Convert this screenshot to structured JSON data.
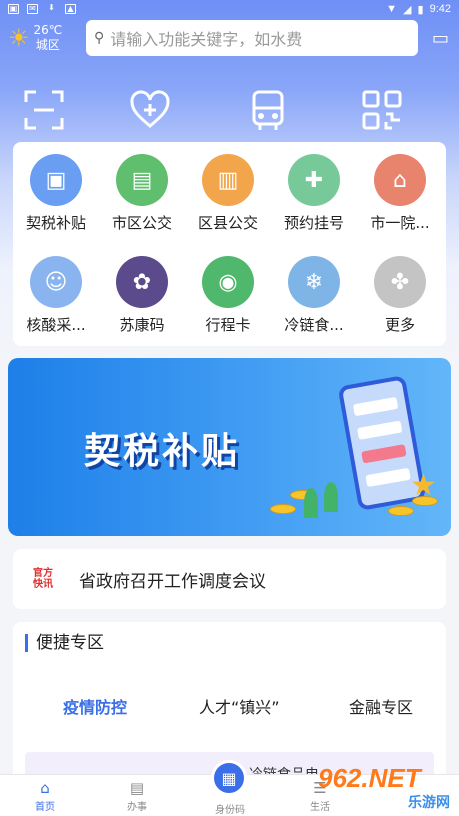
{
  "status_bar": {
    "time": "9:42"
  },
  "weather": {
    "temperature": "26℃",
    "district": "城区"
  },
  "search": {
    "placeholder": "请输入功能关键字，如水费"
  },
  "quick_icons": [
    "scan-icon",
    "heart-plus-icon",
    "bus-icon",
    "qr-code-icon"
  ],
  "services": [
    {
      "label": "契税补贴",
      "icon": "wallet-icon",
      "color": "#6a9ef2"
    },
    {
      "label": "市区公交",
      "icon": "bus-icon",
      "color": "#5fbf6e"
    },
    {
      "label": "区县公交",
      "icon": "bus-stop-icon",
      "color": "#f2a54a"
    },
    {
      "label": "预约挂号",
      "icon": "hospital-desk-icon",
      "color": "#78c99a"
    },
    {
      "label": "市一院...",
      "icon": "hospital-icon",
      "color": "#e8836e"
    },
    {
      "label": "核酸采...",
      "icon": "doctor-icon",
      "color": "#8ab4ef"
    },
    {
      "label": "苏康码",
      "icon": "seal-icon",
      "color": "#5b4a8c"
    },
    {
      "label": "行程卡",
      "icon": "phone-location-icon",
      "color": "#4fb86c"
    },
    {
      "label": "冷链食...",
      "icon": "cold-chain-icon",
      "color": "#7fb5e6"
    },
    {
      "label": "更多",
      "icon": "more-icon",
      "color": "#c4c4c4"
    }
  ],
  "banner": {
    "title": "契税补贴"
  },
  "news": {
    "logo_line1": "官方",
    "logo_line2": "快讯",
    "text": "省政府召开工作调度会议"
  },
  "quick_zone": {
    "title": "便捷专区",
    "tabs": [
      "疫情防控",
      "人才“镇兴”",
      "金融专区"
    ],
    "strip_text": "冷链食品电"
  },
  "tabbar": {
    "home": "首页",
    "office": "办事",
    "idcode": "身份码",
    "life": "生活"
  },
  "watermark": {
    "brand": "962.NET",
    "sub": "乐游网"
  }
}
